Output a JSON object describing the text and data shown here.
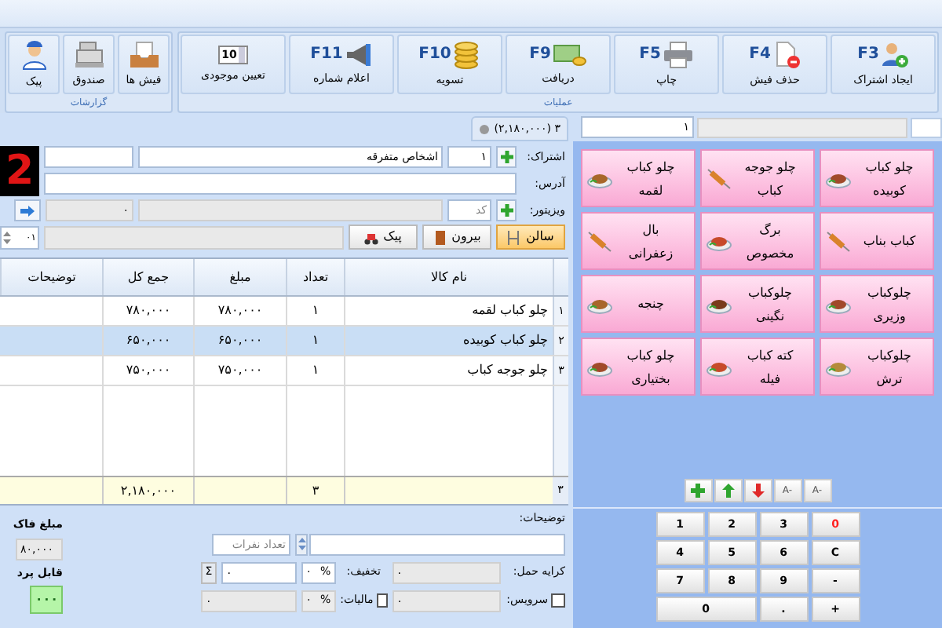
{
  "ribbon": {
    "groups": [
      {
        "label": "عملیات",
        "buttons": [
          {
            "key": "F3",
            "label": "ایجاد اشتراک"
          },
          {
            "key": "F4",
            "label": "حذف فیش"
          },
          {
            "key": "F5",
            "label": "چاپ"
          },
          {
            "key": "F9",
            "label": "دریافت"
          },
          {
            "key": "F10",
            "label": "تسویه"
          },
          {
            "key": "F11",
            "label": "اعلام شماره"
          },
          {
            "counter": "10",
            "label": "تعیین موجودی"
          }
        ]
      },
      {
        "label": "گزارشات",
        "buttons": [
          {
            "label": "فیش ها"
          },
          {
            "label": "صندوق"
          },
          {
            "label": "پیک"
          }
        ]
      }
    ]
  },
  "top_fields": {
    "number": "۱"
  },
  "order_tab": {
    "label": "۳ (۲,۱۸۰,۰۰۰)"
  },
  "customer": {
    "subscription_label": "اشتراک:",
    "subscription_code": "۱",
    "subscription_name": "اشخاص متفرقه",
    "address_label": "آدرس:",
    "visitor_label": "ویزیتور:",
    "visitor_code_placeholder": "کد",
    "visitor_amount": "۰",
    "display": "2"
  },
  "order_types": [
    {
      "label": "سالن",
      "selected": true
    },
    {
      "label": "بیرون",
      "selected": false
    },
    {
      "label": "پیک",
      "selected": false
    }
  ],
  "table_number": "۰۱",
  "table": {
    "columns": [
      "نام کالا",
      "تعداد",
      "مبلغ",
      "جمع کل",
      "توضیحات"
    ],
    "rows": [
      {
        "number": "۱",
        "name": "چلو کباب لقمه",
        "qty": "۱",
        "price": "۷۸۰,۰۰۰",
        "total": "۷۸۰,۰۰۰",
        "selected": false
      },
      {
        "number": "۲",
        "name": "چلو کباب کوبیده",
        "qty": "۱",
        "price": "۶۵۰,۰۰۰",
        "total": "۶۵۰,۰۰۰",
        "selected": true
      },
      {
        "number": "۳",
        "name": "چلو جوجه کباب",
        "qty": "۱",
        "price": "۷۵۰,۰۰۰",
        "total": "۷۵۰,۰۰۰",
        "selected": false
      }
    ],
    "footer": {
      "number": "۳",
      "qty": "۳",
      "total": "۲,۱۸۰,۰۰۰"
    }
  },
  "bottom": {
    "notes_label": "توضیحات:",
    "guests_placeholder": "تعداد نفرات",
    "shipping_label": "کرایه حمل:",
    "shipping": "۰",
    "discount_label": "تخفیف:",
    "discount_unit": "%",
    "discount_percent": "۰",
    "discount": "۰",
    "sum_button": "Σ",
    "service_label": "سرویس:",
    "service_checked": false,
    "service": "۰",
    "tax_label": "مالیات:",
    "tax_checked": false,
    "tax_unit": "%",
    "tax_percent": "۰",
    "tax": "۰",
    "invoice_label": "مبلغ فاک",
    "invoice": "۸۰,۰۰۰",
    "payable_label": "قابل پرد",
    "payable": "۰۰۰"
  },
  "menu": [
    {
      "lines": [
        "چلو کباب",
        "کوبیده"
      ]
    },
    {
      "lines": [
        "چلو جوجه",
        "کباب"
      ]
    },
    {
      "lines": [
        "چلو کباب",
        "لقمه"
      ]
    },
    {
      "lines": [
        "کباب بناب"
      ]
    },
    {
      "lines": [
        "برگ",
        "مخصوص"
      ]
    },
    {
      "lines": [
        "بال",
        "زعفرانی"
      ]
    },
    {
      "lines": [
        "چلوکباب",
        "وزیری"
      ]
    },
    {
      "lines": [
        "چلوکباب",
        "نگینی"
      ]
    },
    {
      "lines": [
        "چنجه"
      ]
    },
    {
      "lines": [
        "چلوکباب",
        "ترش"
      ]
    },
    {
      "lines": [
        "کته کباب",
        "فیله"
      ]
    },
    {
      "lines": [
        "چلو کباب",
        "بختیاری"
      ]
    }
  ],
  "toolbar": [
    {
      "kind": "text",
      "label": "A-"
    },
    {
      "kind": "text",
      "label": "A-"
    },
    {
      "kind": "down"
    },
    {
      "kind": "up"
    },
    {
      "kind": "add"
    }
  ],
  "keypad": [
    {
      "label": "0",
      "color": "#ff2020",
      "wide": false
    },
    {
      "label": "3",
      "color": "#000000",
      "wide": false
    },
    {
      "label": "2",
      "color": "#000000",
      "wide": false
    },
    {
      "label": "1",
      "color": "#000000",
      "wide": false
    },
    {
      "label": "C",
      "color": "#000000",
      "wide": false
    },
    {
      "label": "6",
      "color": "#000000",
      "wide": false
    },
    {
      "label": "5",
      "color": "#000000",
      "wide": false
    },
    {
      "label": "4",
      "color": "#000000",
      "wide": false
    },
    {
      "label": "-",
      "color": "#000000",
      "wide": false
    },
    {
      "label": "9",
      "color": "#000000",
      "wide": false
    },
    {
      "label": "8",
      "color": "#000000",
      "wide": false
    },
    {
      "label": "7",
      "color": "#000000",
      "wide": false
    },
    {
      "label": "+",
      "color": "#000000",
      "wide": false
    },
    {
      "label": ".",
      "color": "#000000",
      "wide": false
    },
    {
      "label": "0",
      "color": "#000000",
      "wide": true
    }
  ]
}
